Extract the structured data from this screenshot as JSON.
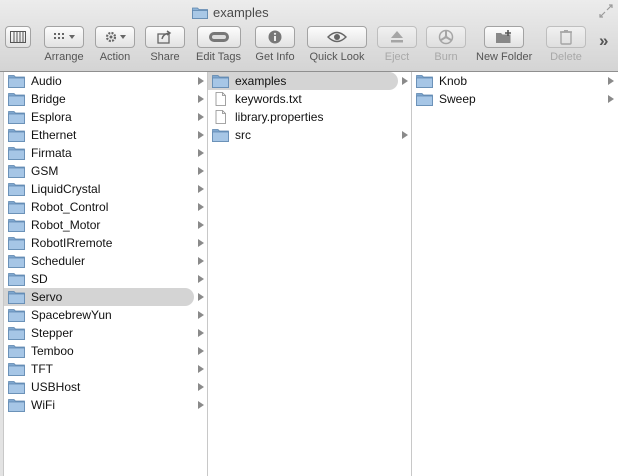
{
  "window": {
    "title": "examples"
  },
  "toolbar": {
    "arrange": "Arrange",
    "action": "Action",
    "share": "Share",
    "edit_tags": "Edit Tags",
    "get_info": "Get Info",
    "quick_look": "Quick Look",
    "eject": "Eject",
    "burn": "Burn",
    "new_folder": "New Folder",
    "delete": "Delete",
    "overflow": "»"
  },
  "columns": [
    {
      "items": [
        {
          "label": "Audio",
          "type": "folder"
        },
        {
          "label": "Bridge",
          "type": "folder"
        },
        {
          "label": "Esplora",
          "type": "folder"
        },
        {
          "label": "Ethernet",
          "type": "folder"
        },
        {
          "label": "Firmata",
          "type": "folder"
        },
        {
          "label": "GSM",
          "type": "folder"
        },
        {
          "label": "LiquidCrystal",
          "type": "folder"
        },
        {
          "label": "Robot_Control",
          "type": "folder"
        },
        {
          "label": "Robot_Motor",
          "type": "folder"
        },
        {
          "label": "RobotIRremote",
          "type": "folder"
        },
        {
          "label": "Scheduler",
          "type": "folder"
        },
        {
          "label": "SD",
          "type": "folder"
        },
        {
          "label": "Servo",
          "type": "folder",
          "selected": true
        },
        {
          "label": "SpacebrewYun",
          "type": "folder"
        },
        {
          "label": "Stepper",
          "type": "folder"
        },
        {
          "label": "Temboo",
          "type": "folder"
        },
        {
          "label": "TFT",
          "type": "folder"
        },
        {
          "label": "USBHost",
          "type": "folder"
        },
        {
          "label": "WiFi",
          "type": "folder"
        }
      ]
    },
    {
      "items": [
        {
          "label": "examples",
          "type": "folder",
          "selected": true
        },
        {
          "label": "keywords.txt",
          "type": "file"
        },
        {
          "label": "library.properties",
          "type": "file"
        },
        {
          "label": "src",
          "type": "folder"
        }
      ]
    },
    {
      "items": [
        {
          "label": "Knob",
          "type": "folder"
        },
        {
          "label": "Sweep",
          "type": "folder"
        }
      ]
    }
  ]
}
